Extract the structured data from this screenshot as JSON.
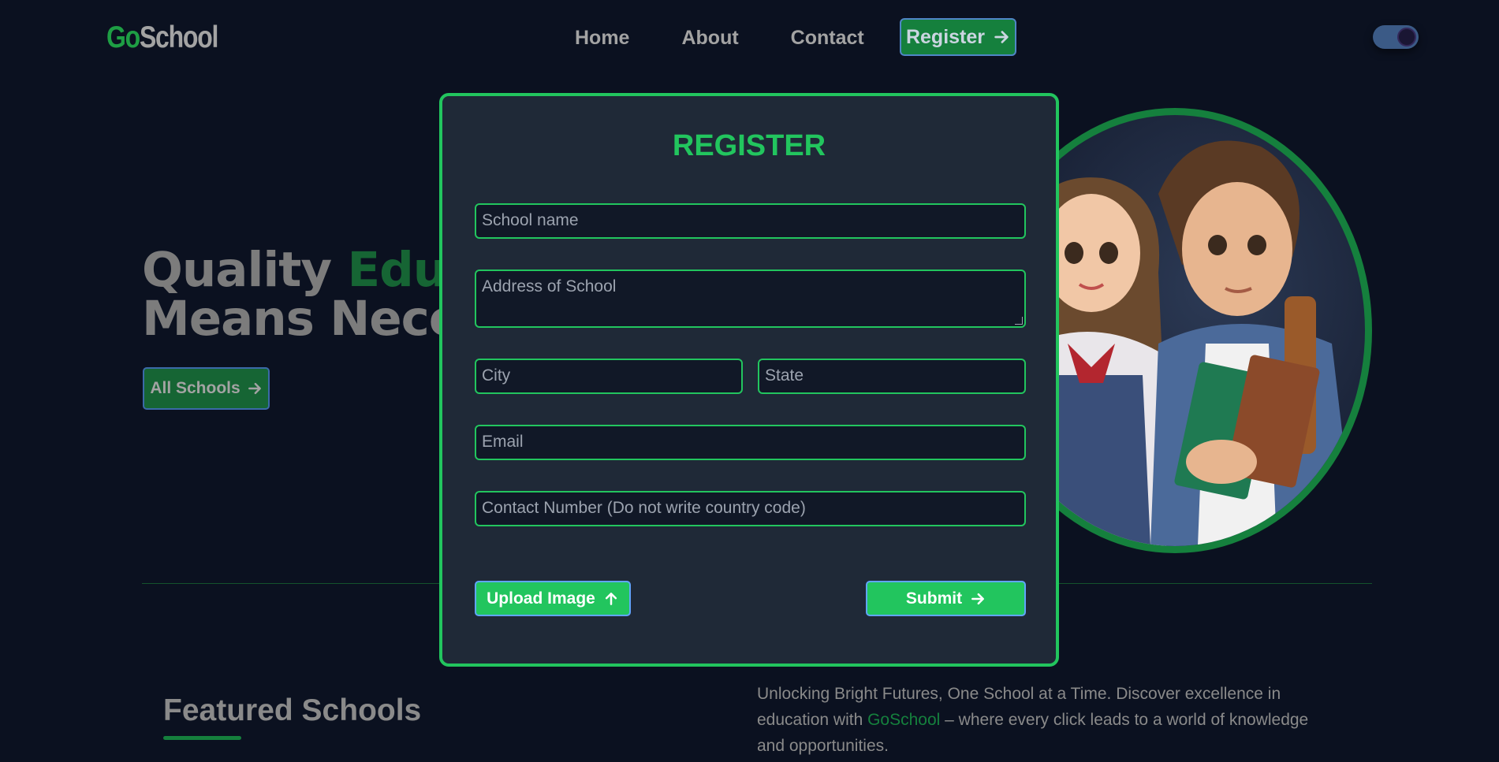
{
  "nav": {
    "logo_prefix": "Go",
    "logo_suffix": "School",
    "links": [
      {
        "label": "Home"
      },
      {
        "label": "About"
      },
      {
        "label": "Contact"
      }
    ],
    "register_label": "Register",
    "theme_toggle_icon": "moon-icon"
  },
  "hero": {
    "title_line1_plain": "Quality ",
    "title_line1_accent": "Educ",
    "title_line2": "Means Nece",
    "all_schools_label": "All Schools"
  },
  "featured": {
    "heading": "Featured Schools",
    "tagline_before": "Unlocking Bright Futures, One School at a Time. Discover excellence in education with ",
    "tagline_brand": "GoSchool",
    "tagline_after": " – where every click leads to a world of knowledge and opportunities."
  },
  "modal": {
    "title": "REGISTER",
    "fields": {
      "school_name": {
        "placeholder": "School name",
        "value": ""
      },
      "address": {
        "placeholder": "Address of School",
        "value": ""
      },
      "city": {
        "placeholder": "City",
        "value": ""
      },
      "state": {
        "placeholder": "State",
        "value": ""
      },
      "email": {
        "placeholder": "Email",
        "value": ""
      },
      "contact": {
        "placeholder": "Contact Number (Do not write country code)",
        "value": ""
      }
    },
    "upload_label": "Upload Image",
    "submit_label": "Submit"
  },
  "colors": {
    "accent": "#22c55e",
    "accent_dark": "#15803d",
    "background": "#0b1120",
    "modal_bg": "#1f2937"
  }
}
